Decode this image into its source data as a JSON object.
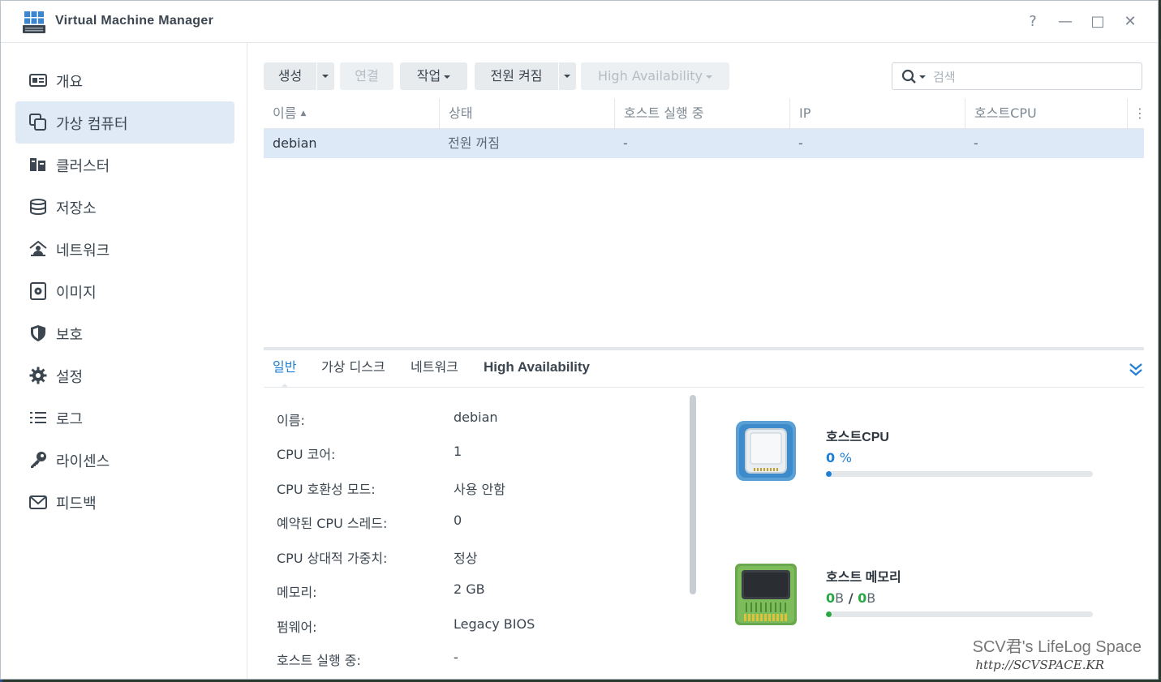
{
  "window": {
    "title": "Virtual Machine Manager",
    "controls": [
      "?",
      "—",
      "□",
      "✕"
    ]
  },
  "sidebar": {
    "items": [
      {
        "label": "개요",
        "icon": "overview-icon"
      },
      {
        "label": "가상 컴퓨터",
        "icon": "virtual-machine-icon",
        "active": true
      },
      {
        "label": "클러스터",
        "icon": "cluster-icon"
      },
      {
        "label": "저장소",
        "icon": "storage-icon"
      },
      {
        "label": "네트워크",
        "icon": "network-icon"
      },
      {
        "label": "이미지",
        "icon": "image-icon"
      },
      {
        "label": "보호",
        "icon": "shield-icon"
      },
      {
        "label": "설정",
        "icon": "gear-icon"
      },
      {
        "label": "로그",
        "icon": "list-icon"
      },
      {
        "label": "라이센스",
        "icon": "key-icon"
      },
      {
        "label": "피드백",
        "icon": "mail-icon"
      }
    ]
  },
  "toolbar": {
    "create": "생성",
    "connect": "연결",
    "action": "작업",
    "power_on": "전원 켜짐",
    "high_availability": "High Availability",
    "search_placeholder": "검색"
  },
  "grid": {
    "columns": [
      "이름",
      "상태",
      "호스트 실행 중",
      "IP",
      "호스트CPU"
    ],
    "sort_column": "이름",
    "rows": [
      {
        "name": "debian",
        "status": "전원 꺼짐",
        "host": "-",
        "ip": "-",
        "host_cpu": "-"
      }
    ]
  },
  "detail_tabs": [
    "일반",
    "가상 디스크",
    "네트워크",
    "High Availability"
  ],
  "detail": {
    "properties": [
      {
        "label": "이름:",
        "value": "debian"
      },
      {
        "label": "CPU 코어:",
        "value": "1"
      },
      {
        "label": "CPU 호환성 모드:",
        "value": "사용 안함"
      },
      {
        "label": "예약된 CPU 스레드:",
        "value": "0"
      },
      {
        "label": "CPU 상대적 가중치:",
        "value": "정상"
      },
      {
        "label": "메모리:",
        "value": "2 GB"
      },
      {
        "label": "펌웨어:",
        "value": "Legacy BIOS"
      },
      {
        "label": "호스트 실행 중:",
        "value": "-"
      }
    ],
    "host_cpu": {
      "title": "호스트CPU",
      "value": "0",
      "unit": "%",
      "usage": 0.02,
      "color": "#1f7fd4"
    },
    "host_memory": {
      "title": "호스트 메모리",
      "used": "0",
      "used_unit": "B",
      "sep": "/",
      "total": "0",
      "total_unit": "B",
      "usage": 0.02,
      "color": "#28a745"
    }
  },
  "watermark": {
    "line1": "SCV君's LifeLog Space",
    "line2": "http://SCVSPACE.KR"
  }
}
